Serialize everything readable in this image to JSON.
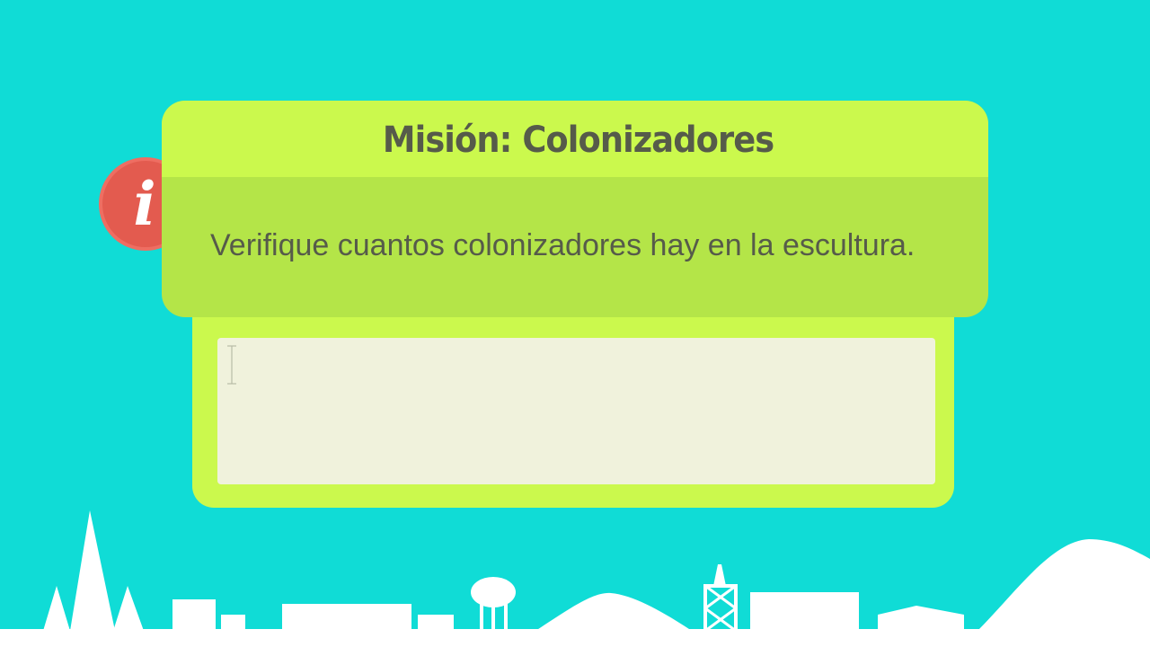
{
  "mission": {
    "title": "Misión: Colonizadores",
    "instruction": "Verifique cuantos colonizadores hay en la escultura."
  },
  "answer": {
    "value": "",
    "placeholder": ""
  },
  "icons": {
    "info": "info-icon",
    "caret": "text-cursor-icon",
    "skyline": "city-skyline-icon"
  },
  "colors": {
    "background": "#10dcd6",
    "header": "#cbf94d",
    "body": "#b4e548",
    "badge": "#e35b4f",
    "input": "#f0f2dc",
    "text": "#565b4a"
  }
}
